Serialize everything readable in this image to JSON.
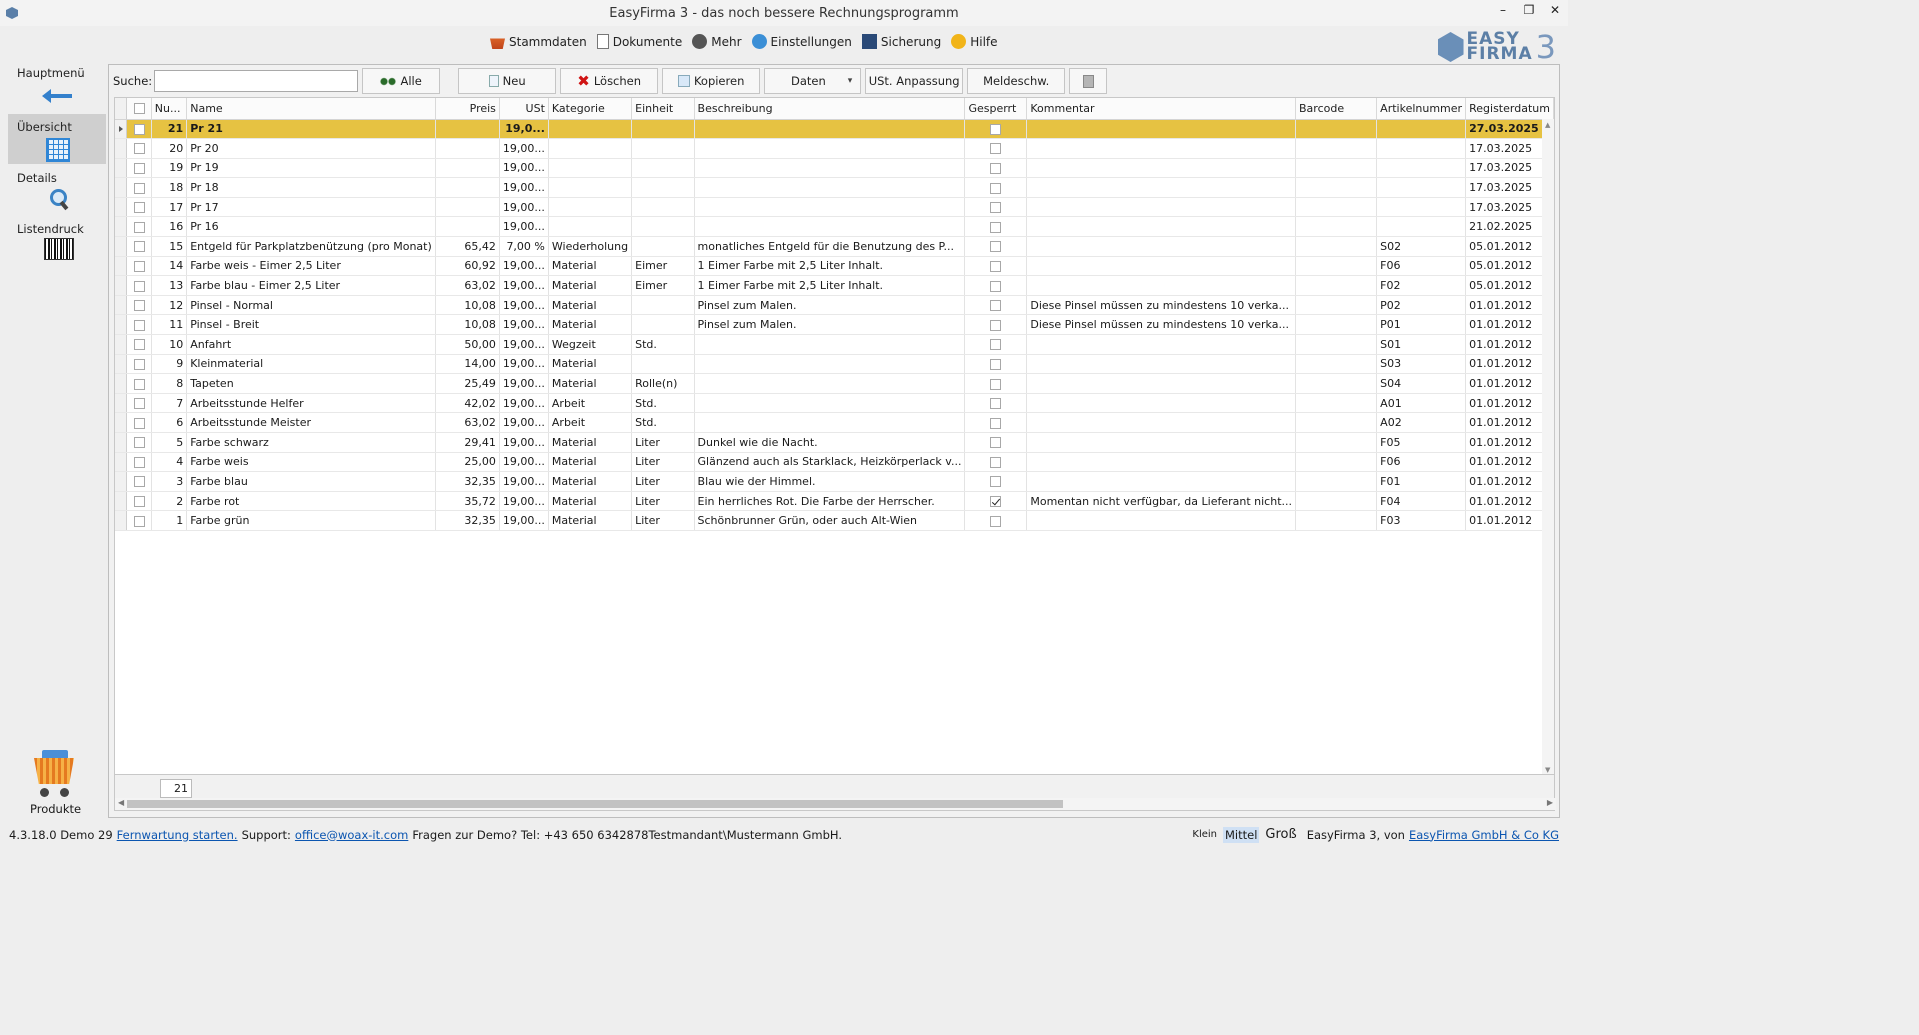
{
  "window": {
    "title": "EasyFirma 3 - das noch bessere Rechnungsprogramm",
    "minimize": "–",
    "restore": "❐",
    "close": "✕"
  },
  "menu": [
    {
      "name": "menu-stammdaten",
      "icon": "ic-stamm",
      "label": "Stammdaten"
    },
    {
      "name": "menu-dokumente",
      "icon": "ic-doc",
      "label": "Dokumente"
    },
    {
      "name": "menu-mehr",
      "icon": "ic-mehr",
      "label": "Mehr"
    },
    {
      "name": "menu-einstellungen",
      "icon": "ic-einst",
      "label": "Einstellungen"
    },
    {
      "name": "menu-sicherung",
      "icon": "ic-sich",
      "label": "Sicherung"
    },
    {
      "name": "menu-hilfe",
      "icon": "ic-hilfe",
      "label": "Hilfe"
    }
  ],
  "logo": {
    "line1": "EASY",
    "line2": "FIRMA",
    "num": "3"
  },
  "sidebar": {
    "hauptmenu": "Hauptmenü",
    "ubersicht": "Übersicht",
    "details": "Details",
    "listendruck": "Listendruck",
    "produkte": "Produkte"
  },
  "toolbar": {
    "search_label": "Suche:",
    "search_value": "",
    "alle": "Alle",
    "neu": "Neu",
    "loeschen": "Löschen",
    "kopieren": "Kopieren",
    "daten": "Daten",
    "ust_anpassung": "USt. Anpassung",
    "meldeschw": "Meldeschw."
  },
  "columns": [
    "Nu...",
    "Name",
    "Preis",
    "USt",
    "Kategorie",
    "Einheit",
    "Beschreibung",
    "Gesperrt",
    "Kommentar",
    "Barcode",
    "Artikelnummer",
    "Registerdatum"
  ],
  "rows": [
    {
      "nr": "21",
      "name": "Pr 21",
      "preis": "",
      "ust": "19,0...",
      "kat": "",
      "einheit": "",
      "beschr": "",
      "gesperrt": false,
      "komm": "",
      "barcode": "",
      "art": "",
      "datum": "27.03.2025",
      "selected": true
    },
    {
      "nr": "20",
      "name": "Pr 20",
      "preis": "",
      "ust": "19,00...",
      "kat": "",
      "einheit": "",
      "beschr": "",
      "gesperrt": false,
      "komm": "",
      "barcode": "",
      "art": "",
      "datum": "17.03.2025"
    },
    {
      "nr": "19",
      "name": "Pr 19",
      "preis": "",
      "ust": "19,00...",
      "kat": "",
      "einheit": "",
      "beschr": "",
      "gesperrt": false,
      "komm": "",
      "barcode": "",
      "art": "",
      "datum": "17.03.2025"
    },
    {
      "nr": "18",
      "name": "Pr 18",
      "preis": "",
      "ust": "19,00...",
      "kat": "",
      "einheit": "",
      "beschr": "",
      "gesperrt": false,
      "komm": "",
      "barcode": "",
      "art": "",
      "datum": "17.03.2025"
    },
    {
      "nr": "17",
      "name": "Pr 17",
      "preis": "",
      "ust": "19,00...",
      "kat": "",
      "einheit": "",
      "beschr": "",
      "gesperrt": false,
      "komm": "",
      "barcode": "",
      "art": "",
      "datum": "17.03.2025"
    },
    {
      "nr": "16",
      "name": "Pr 16",
      "preis": "",
      "ust": "19,00...",
      "kat": "",
      "einheit": "",
      "beschr": "",
      "gesperrt": false,
      "komm": "",
      "barcode": "",
      "art": "",
      "datum": "21.02.2025"
    },
    {
      "nr": "15",
      "name": "Entgeld für Parkplatzbenützung (pro Monat)",
      "preis": "65,42",
      "ust": "7,00 %",
      "kat": "Wiederholung",
      "einheit": "",
      "beschr": "monatliches Entgeld für die Benutzung des P...",
      "gesperrt": false,
      "komm": "",
      "barcode": "",
      "art": "S02",
      "datum": "05.01.2012"
    },
    {
      "nr": "14",
      "name": "Farbe weis - Eimer 2,5 Liter",
      "preis": "60,92",
      "ust": "19,00...",
      "kat": "Material",
      "einheit": "Eimer",
      "beschr": "1 Eimer Farbe mit 2,5 Liter Inhalt.",
      "gesperrt": false,
      "komm": "",
      "barcode": "",
      "art": "F06",
      "datum": "05.01.2012"
    },
    {
      "nr": "13",
      "name": "Farbe blau - Eimer 2,5 Liter",
      "preis": "63,02",
      "ust": "19,00...",
      "kat": "Material",
      "einheit": "Eimer",
      "beschr": "1 Eimer Farbe mit 2,5 Liter Inhalt.",
      "gesperrt": false,
      "komm": "",
      "barcode": "",
      "art": "F02",
      "datum": "05.01.2012"
    },
    {
      "nr": "12",
      "name": "Pinsel - Normal",
      "preis": "10,08",
      "ust": "19,00...",
      "kat": "Material",
      "einheit": "",
      "beschr": "Pinsel zum Malen.",
      "gesperrt": false,
      "komm": "Diese Pinsel müssen zu mindestens 10 verka...",
      "barcode": "",
      "art": "P02",
      "datum": "01.01.2012"
    },
    {
      "nr": "11",
      "name": "Pinsel - Breit",
      "preis": "10,08",
      "ust": "19,00...",
      "kat": "Material",
      "einheit": "",
      "beschr": "Pinsel zum Malen.",
      "gesperrt": false,
      "komm": "Diese Pinsel müssen zu mindestens 10 verka...",
      "barcode": "",
      "art": "P01",
      "datum": "01.01.2012"
    },
    {
      "nr": "10",
      "name": "Anfahrt",
      "preis": "50,00",
      "ust": "19,00...",
      "kat": "Wegzeit",
      "einheit": "Std.",
      "beschr": "",
      "gesperrt": false,
      "komm": "",
      "barcode": "",
      "art": "S01",
      "datum": "01.01.2012"
    },
    {
      "nr": "9",
      "name": "Kleinmaterial",
      "preis": "14,00",
      "ust": "19,00...",
      "kat": "Material",
      "einheit": "",
      "beschr": "",
      "gesperrt": false,
      "komm": "",
      "barcode": "",
      "art": "S03",
      "datum": "01.01.2012"
    },
    {
      "nr": "8",
      "name": "Tapeten",
      "preis": "25,49",
      "ust": "19,00...",
      "kat": "Material",
      "einheit": "Rolle(n)",
      "beschr": "",
      "gesperrt": false,
      "komm": "",
      "barcode": "",
      "art": "S04",
      "datum": "01.01.2012"
    },
    {
      "nr": "7",
      "name": "Arbeitsstunde Helfer",
      "preis": "42,02",
      "ust": "19,00...",
      "kat": "Arbeit",
      "einheit": "Std.",
      "beschr": "",
      "gesperrt": false,
      "komm": "",
      "barcode": "",
      "art": "A01",
      "datum": "01.01.2012"
    },
    {
      "nr": "6",
      "name": "Arbeitsstunde Meister",
      "preis": "63,02",
      "ust": "19,00...",
      "kat": "Arbeit",
      "einheit": "Std.",
      "beschr": "",
      "gesperrt": false,
      "komm": "",
      "barcode": "",
      "art": "A02",
      "datum": "01.01.2012"
    },
    {
      "nr": "5",
      "name": "Farbe schwarz",
      "preis": "29,41",
      "ust": "19,00...",
      "kat": "Material",
      "einheit": "Liter",
      "beschr": "Dunkel wie die Nacht.",
      "gesperrt": false,
      "komm": "",
      "barcode": "",
      "art": "F05",
      "datum": "01.01.2012"
    },
    {
      "nr": "4",
      "name": "Farbe weis",
      "preis": "25,00",
      "ust": "19,00...",
      "kat": "Material",
      "einheit": "Liter",
      "beschr": "Glänzend auch als Starklack, Heizkörperlack v...",
      "gesperrt": false,
      "komm": "",
      "barcode": "",
      "art": "F06",
      "datum": "01.01.2012"
    },
    {
      "nr": "3",
      "name": "Farbe blau",
      "preis": "32,35",
      "ust": "19,00...",
      "kat": "Material",
      "einheit": "Liter",
      "beschr": "Blau wie der Himmel.",
      "gesperrt": false,
      "komm": "",
      "barcode": "",
      "art": "F01",
      "datum": "01.01.2012"
    },
    {
      "nr": "2",
      "name": "Farbe rot",
      "preis": "35,72",
      "ust": "19,00...",
      "kat": "Material",
      "einheit": "Liter",
      "beschr": "Ein herrliches Rot. Die Farbe der Herrscher.",
      "gesperrt": true,
      "komm": "Momentan nicht verfügbar, da Lieferant nicht...",
      "barcode": "",
      "art": "F04",
      "datum": "01.01.2012"
    },
    {
      "nr": "1",
      "name": "Farbe grün",
      "preis": "32,35",
      "ust": "19,00...",
      "kat": "Material",
      "einheit": "Liter",
      "beschr": "Schönbrunner Grün, oder auch Alt-Wien",
      "gesperrt": false,
      "komm": "",
      "barcode": "",
      "art": "F03",
      "datum": "01.01.2012"
    }
  ],
  "row_count": "21",
  "status": {
    "version": "4.3.18.0 Demo 29",
    "fernwartung": "Fernwartung starten.",
    "support_label": "Support:",
    "email": "office@woax-it.com",
    "demo_text": "Fragen zur Demo? Tel: +43 650 6342878",
    "mandant": "Testmandant\\Mustermann GmbH.",
    "klein": "Klein",
    "mittel": "Mittel",
    "gross": "Groß",
    "app_von": "EasyFirma 3, von",
    "company_link": "EasyFirma GmbH & Co KG"
  }
}
